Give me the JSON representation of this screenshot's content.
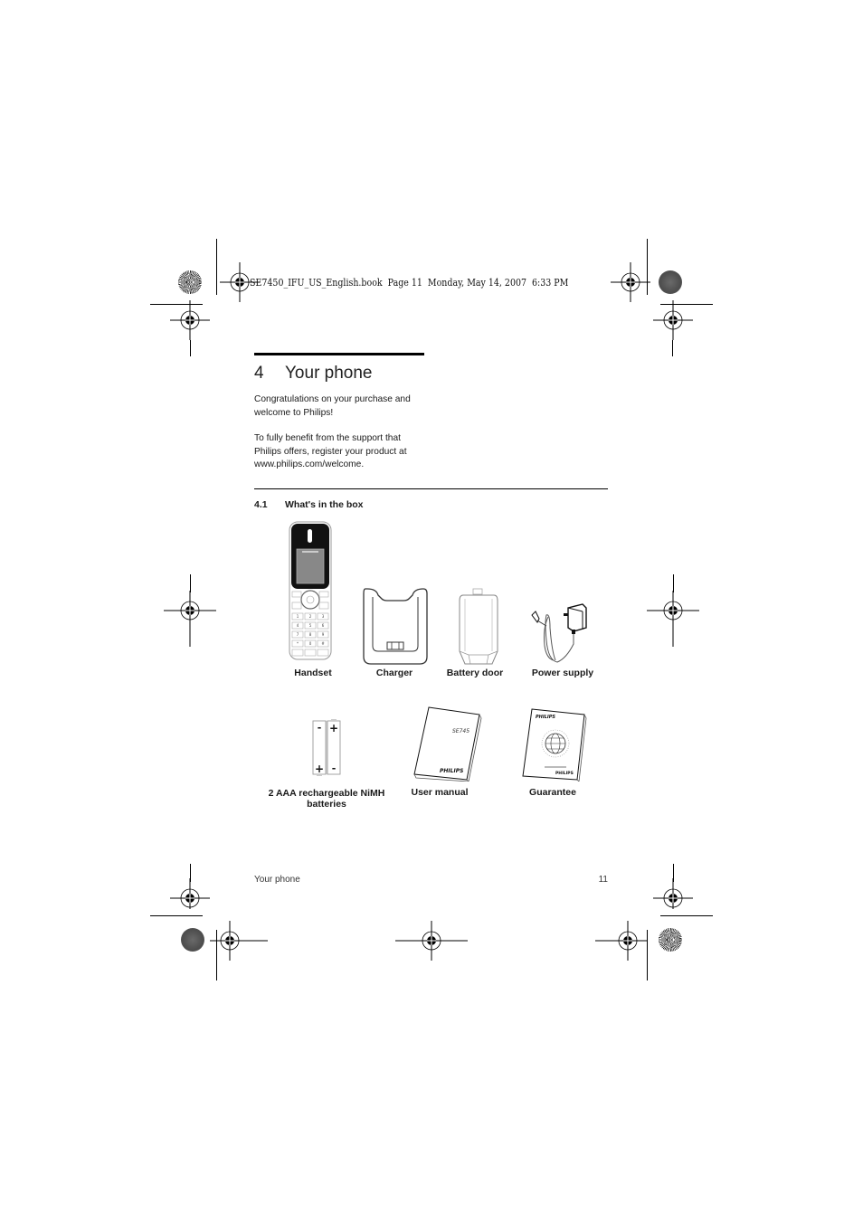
{
  "print_header": {
    "text": "SE7450_IFU_US_English.book  Page 11  Monday, May 14, 2007  6:33 PM"
  },
  "chapter": {
    "number": "4",
    "title": "Your phone"
  },
  "intro": {
    "paragraph1": [
      "Congratulations on your purchase and",
      "welcome to Philips!"
    ],
    "paragraph2": [
      "To fully benefit from the support that",
      "Philips offers, register your product at",
      "www.philips.com/welcome."
    ]
  },
  "section": {
    "number": "4.1",
    "title": "What's in the box"
  },
  "box_items": {
    "row1": [
      {
        "label": "Handset",
        "icon": "handset-illustration"
      },
      {
        "label": "Charger",
        "icon": "charger-illustration"
      },
      {
        "label": "Battery door",
        "icon": "battery-door-illustration"
      },
      {
        "label": "Power supply",
        "icon": "power-supply-illustration"
      }
    ],
    "row2": [
      {
        "label_line1": "2 AAA rechargeable NiMH",
        "label_line2": "batteries",
        "icon": "batteries-illustration"
      },
      {
        "label": "User manual",
        "icon": "user-manual-illustration",
        "cover_text": "SE745",
        "brand": "PHILIPS"
      },
      {
        "label": "Guarantee",
        "icon": "guarantee-illustration",
        "brand": "PHILIPS"
      }
    ]
  },
  "footer": {
    "section_name": "Your phone",
    "page_number": "11"
  }
}
